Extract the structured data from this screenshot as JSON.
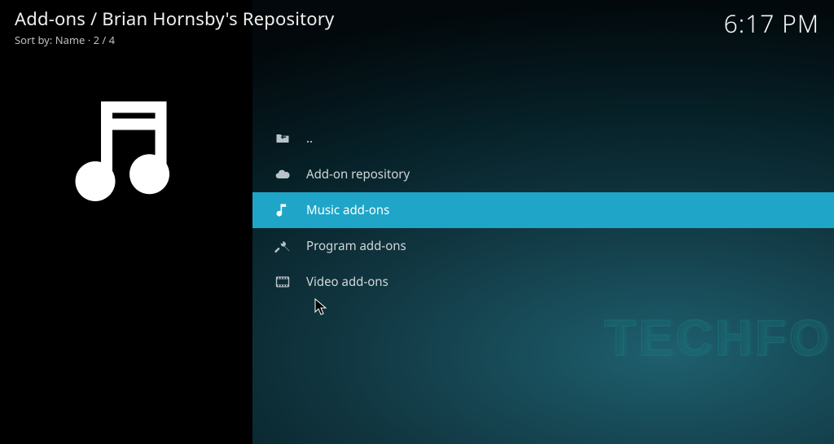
{
  "header": {
    "breadcrumb": "Add-ons / Brian Hornsby's Repository",
    "sort_prefix": "Sort by: ",
    "sort_value": "Name",
    "separator": " · ",
    "position": "2 / 4",
    "clock": "6:17 PM"
  },
  "sidebar": {
    "current_item_kind": "music-addons"
  },
  "list": {
    "items": [
      {
        "icon": "parent-dir-icon",
        "label": ".."
      },
      {
        "icon": "cloud-icon",
        "label": "Add-on repository"
      },
      {
        "icon": "music-note-icon",
        "label": "Music add-ons"
      },
      {
        "icon": "tools-icon",
        "label": "Program add-ons"
      },
      {
        "icon": "film-icon",
        "label": "Video add-ons"
      }
    ],
    "selected_index": 2
  },
  "watermark": {
    "text": "TECHFOLLOWS"
  }
}
